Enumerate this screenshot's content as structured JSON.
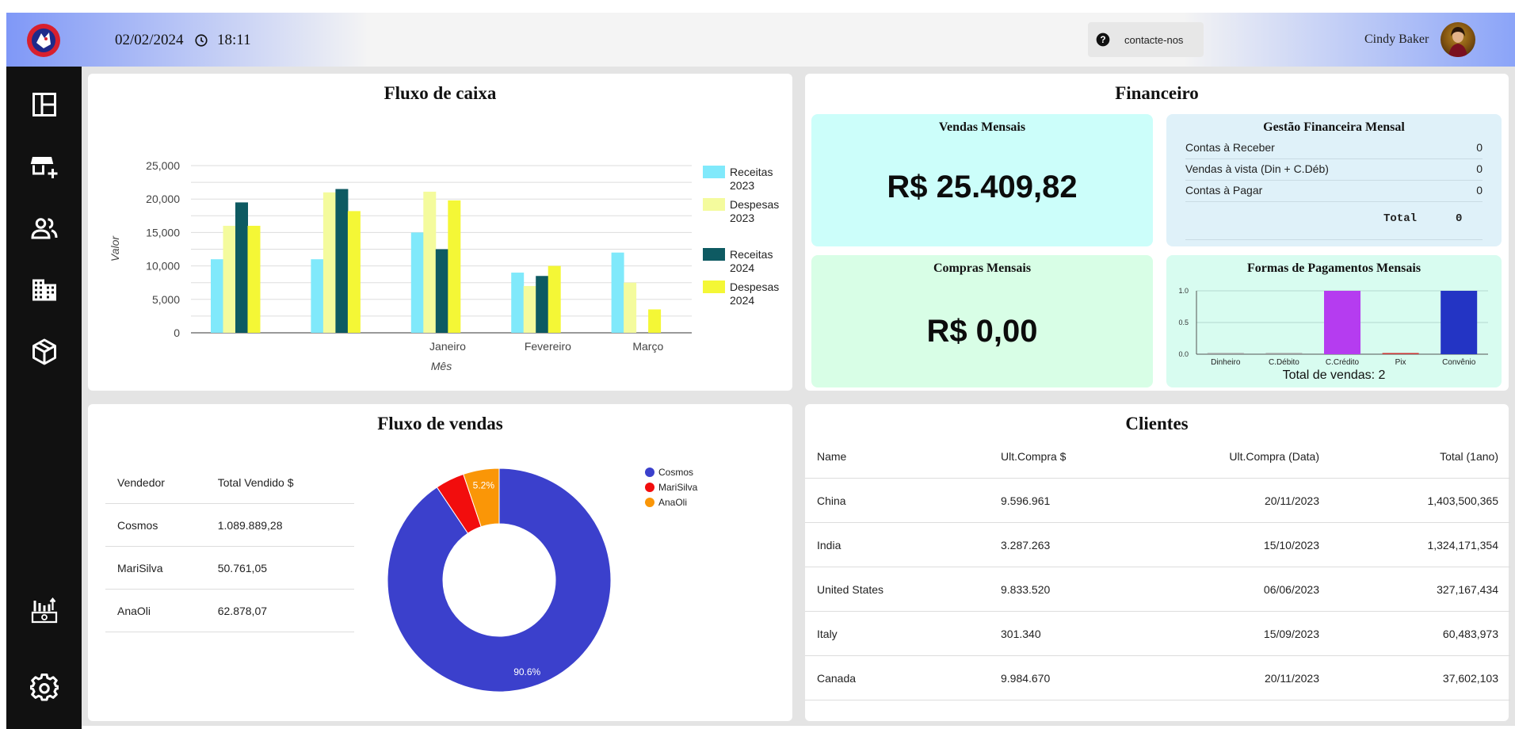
{
  "header": {
    "date": "02/02/2024",
    "time": "18:11",
    "contact_label": "contacte-nos",
    "user_name": "Cindy Baker"
  },
  "sidebar": {
    "items": [
      "dashboard-icon",
      "add-store-icon",
      "people-icon",
      "buildings-icon",
      "box-icon",
      "cash-register-icon",
      "gear-icon"
    ]
  },
  "fluxo_caixa": {
    "title": "Fluxo de caixa"
  },
  "financeiro": {
    "title": "Financeiro",
    "vendas_title": "Vendas Mensais",
    "vendas_value": "R$ 25.409,82",
    "compras_title": "Compras Mensais",
    "compras_value": "R$ 0,00",
    "gestao_title": "Gestão Financeira Mensal",
    "gestao_rows": [
      {
        "label": "Contas à Receber",
        "value": "0"
      },
      {
        "label": "Vendas à vista (Din + C.Déb)",
        "value": "0"
      },
      {
        "label": "Contas à Pagar",
        "value": "0"
      }
    ],
    "gestao_total_label": "Total",
    "gestao_total_value": "0",
    "pagamentos_title": "Formas de Pagamentos Mensais",
    "pagamentos_footer": "Total de vendas: 2"
  },
  "fluxo_vendas": {
    "title": "Fluxo de vendas",
    "headers": [
      "Vendedor",
      "Total Vendido $"
    ],
    "rows": [
      [
        "Cosmos",
        "1.089.889,28"
      ],
      [
        "MariSilva",
        "50.761,05"
      ],
      [
        "AnaOli",
        "62.878,07"
      ]
    ]
  },
  "clientes": {
    "title": "Clientes",
    "headers": [
      "Name",
      "Ult.Compra $",
      "Ult.Compra (Data)",
      "Total (1ano)"
    ],
    "rows": [
      [
        "China",
        "9.596.961",
        "20/11/2023",
        "1,403,500,365"
      ],
      [
        "India",
        "3.287.263",
        "15/10/2023",
        "1,324,171,354"
      ],
      [
        "United States",
        "9.833.520",
        "06/06/2023",
        "327,167,434"
      ],
      [
        "Italy",
        "301.340",
        "15/09/2023",
        "60,483,973"
      ],
      [
        "Canada",
        "9.984.670",
        "20/11/2023",
        "37,602,103"
      ]
    ]
  },
  "chart_data": [
    {
      "type": "bar",
      "xlabel": "Mês",
      "ylabel": "Valor",
      "ylim": [
        0,
        25000
      ],
      "yticks": [
        "0",
        "5,000",
        "10,000",
        "15,000",
        "20,000",
        "25,000"
      ],
      "categories": [
        "",
        "",
        "Janeiro",
        "Fevereiro",
        "Março"
      ],
      "series": [
        {
          "name": "Receitas 2023",
          "color": "#80e9fb",
          "values": [
            11000,
            11000,
            15000,
            9000,
            12000
          ]
        },
        {
          "name": "Despesas 2023",
          "color": "#f4fb9d",
          "values": [
            16000,
            21000,
            21100,
            7000,
            7500
          ]
        },
        {
          "name": "Receitas 2024",
          "color": "#0e5a62",
          "values": [
            19500,
            21500,
            12500,
            8500,
            0
          ]
        },
        {
          "name": "Despesas 2024",
          "color": "#f4f736",
          "values": [
            16000,
            18200,
            19800,
            10000,
            3500
          ]
        }
      ],
      "legend": "right",
      "grid": true
    },
    {
      "type": "bar",
      "categories": [
        "Dinheiro",
        "C.Débito",
        "C.Crédito",
        "Pix",
        "Convênio"
      ],
      "values": [
        0,
        0,
        1,
        0,
        1
      ],
      "colors": [
        "#9c9c9c",
        "#9c9c9c",
        "#b53cf0",
        "#cc3333",
        "#2334c4"
      ],
      "ylim": [
        0,
        1
      ],
      "yticks": [
        "0.0",
        "0.5",
        "1.0"
      ]
    },
    {
      "type": "pie",
      "labels": [
        "Cosmos",
        "MariSilva",
        "AnaOli"
      ],
      "values": [
        90.6,
        4.2,
        5.2
      ],
      "colors": [
        "#3b40cc",
        "#f20d0d",
        "#fa9607"
      ],
      "data_labels": [
        "90.6%",
        "",
        "5.2%"
      ],
      "legend": "top-right"
    }
  ]
}
